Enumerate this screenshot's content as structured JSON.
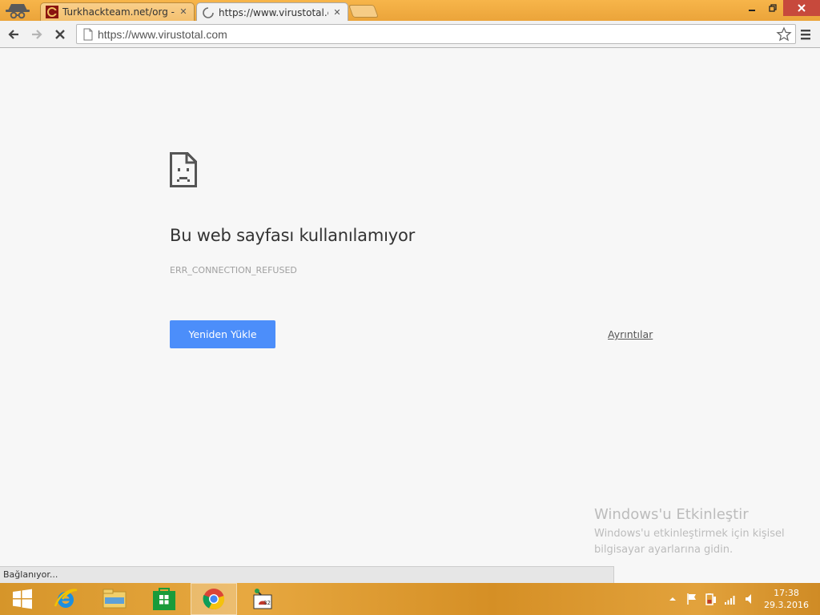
{
  "browser": {
    "tabs": [
      {
        "title": "Turkhackteam.net/org - T",
        "close": "✕"
      },
      {
        "title": "https://www.virustotal.cor",
        "close": "✕"
      }
    ],
    "address": "https://www.virustotal.com",
    "status": "Bağlanıyor..."
  },
  "error_page": {
    "title": "Bu web sayfası kullanılamıyor",
    "code": "ERR_CONNECTION_REFUSED",
    "reload_label": "Yeniden Yükle",
    "details_label": "Ayrıntılar"
  },
  "activation": {
    "title": "Windows'u Etkinleştir",
    "line1": "Windows'u etkinleştirmek için kişisel",
    "line2": "bilgisayar ayarlarına gidin."
  },
  "taskbar": {
    "time": "17:38",
    "date": "29.3.2016",
    "items": [
      "start-icon",
      "internet-explorer-icon",
      "file-explorer-icon",
      "store-icon",
      "chrome-icon",
      "app-icon"
    ]
  },
  "colors": {
    "accent": "#4c8efa",
    "titlebar": "#eba43a",
    "close_button": "#c7493c"
  }
}
